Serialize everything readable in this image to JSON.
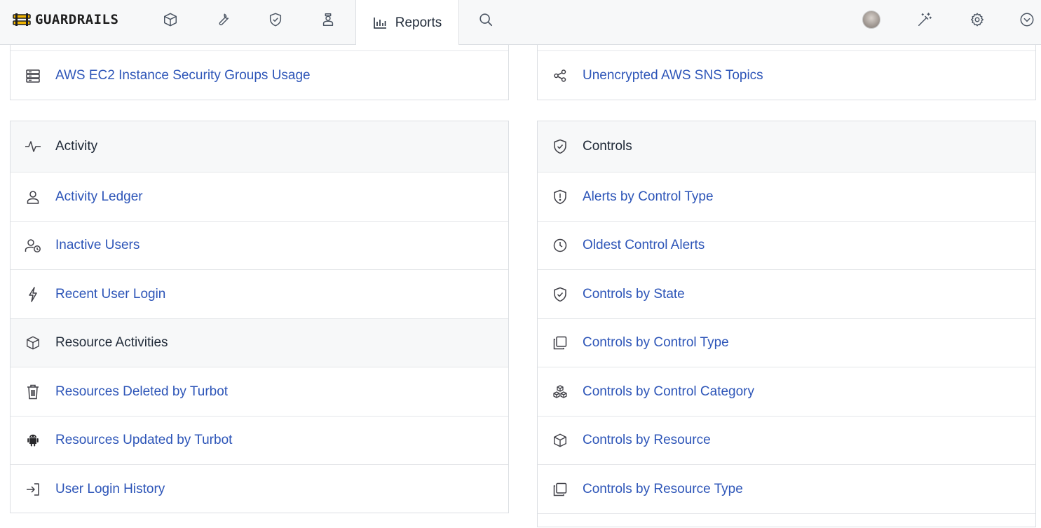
{
  "app": {
    "logo_text": "GUARDRAILS",
    "brand_color": "#f0b400"
  },
  "nav": {
    "icons": [
      "cube-icon",
      "wrench-icon",
      "shield-check-icon",
      "policy-person-icon"
    ],
    "active_tab_label": "Reports",
    "right_icons": [
      "avatar",
      "magic-wand-icon",
      "gear-icon",
      "chevron-down-circle-icon"
    ]
  },
  "top_left_card": {
    "item": {
      "label": "AWS EC2 Instance Security Groups Usage",
      "icon": "server-icon"
    }
  },
  "top_right_card": {
    "item": {
      "label": "Unencrypted AWS SNS Topics",
      "icon": "share-nodes-icon"
    }
  },
  "activity": {
    "title": "Activity",
    "items": [
      {
        "label": "Activity Ledger",
        "icon": "user-icon"
      },
      {
        "label": "Inactive Users",
        "icon": "user-clock-icon"
      },
      {
        "label": "Recent User Login",
        "icon": "lightning-icon"
      }
    ],
    "group": {
      "label": "Resource Activities",
      "icon": "cube-icon"
    },
    "group_items": [
      {
        "label": "Resources Deleted by Turbot",
        "icon": "trash-icon"
      },
      {
        "label": "Resources Updated by Turbot",
        "icon": "android-icon"
      },
      {
        "label": "User Login History",
        "icon": "sign-in-icon"
      }
    ]
  },
  "controls": {
    "title": "Controls",
    "items": [
      {
        "label": "Alerts by Control Type",
        "icon": "shield-alert-icon"
      },
      {
        "label": "Oldest Control Alerts",
        "icon": "clock-icon"
      },
      {
        "label": "Controls by State",
        "icon": "shield-check-icon"
      },
      {
        "label": "Controls by Control Type",
        "icon": "copy-icon"
      },
      {
        "label": "Controls by Control Category",
        "icon": "cubes-icon"
      },
      {
        "label": "Controls by Resource",
        "icon": "cube-icon"
      },
      {
        "label": "Controls by Resource Type",
        "icon": "copy-icon"
      }
    ]
  },
  "colors": {
    "link": "#2d55b8",
    "header_bg": "#f7f8f9",
    "border": "#dcdfe3"
  }
}
